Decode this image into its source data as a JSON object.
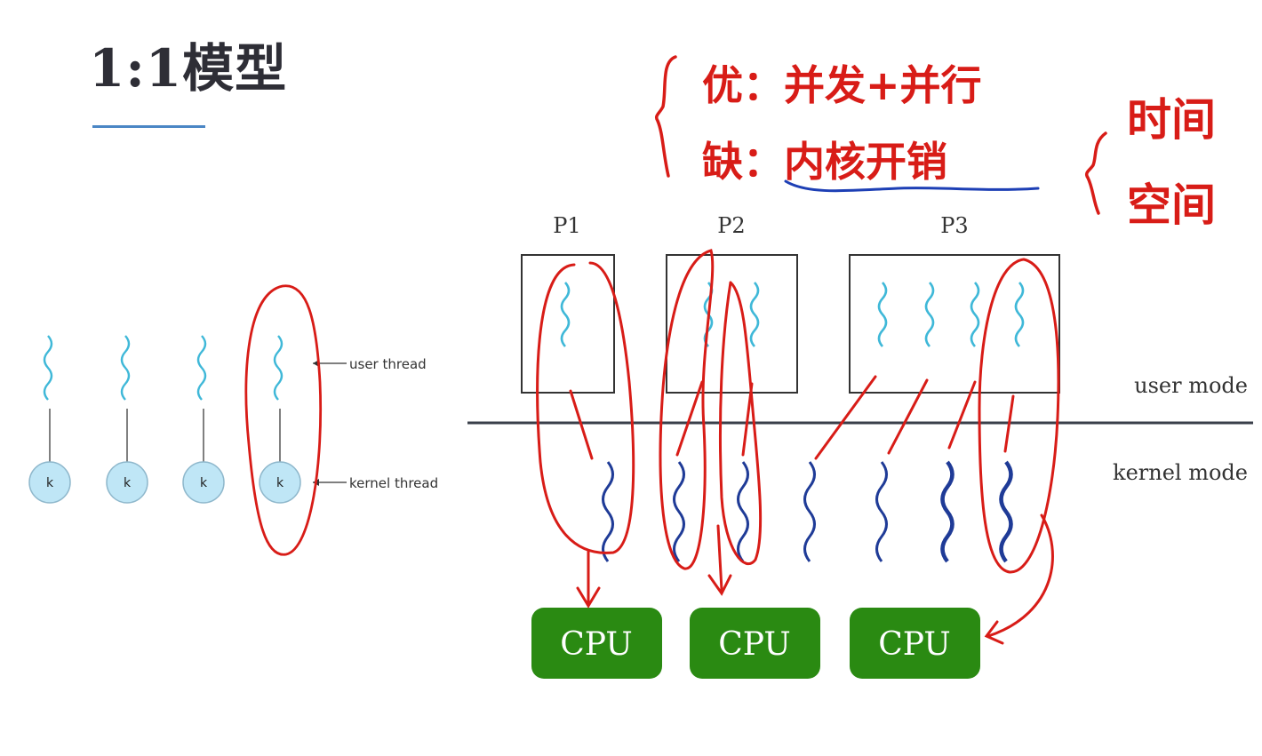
{
  "slide": {
    "title": "1:1模型"
  },
  "left_diagram": {
    "kernel_node_label": "k",
    "user_thread_label": "user thread",
    "kernel_thread_label": "kernel thread"
  },
  "right_diagram": {
    "processes": [
      {
        "label": "P1",
        "thread_count": 1
      },
      {
        "label": "P2",
        "thread_count": 2
      },
      {
        "label": "P3",
        "thread_count": 4
      }
    ],
    "user_mode_label": "user mode",
    "kernel_mode_label": "kernel mode",
    "kernel_thread_count": 7,
    "cpus": [
      {
        "label": "CPU"
      },
      {
        "label": "CPU"
      },
      {
        "label": "CPU"
      }
    ]
  },
  "handwritten_notes": {
    "pros": "优：并发+并行",
    "cons": "缺：内核开销",
    "cost_items": [
      "时间",
      "空间"
    ]
  },
  "colors": {
    "user_thread": "#3fb8d8",
    "kernel_thread": "#1f3b97",
    "kernel_node_fill": "#bfe6f6",
    "cpu_fill": "#2a8a12",
    "annotation_red": "#d81c17",
    "annotation_blue": "#1d3fb5"
  }
}
